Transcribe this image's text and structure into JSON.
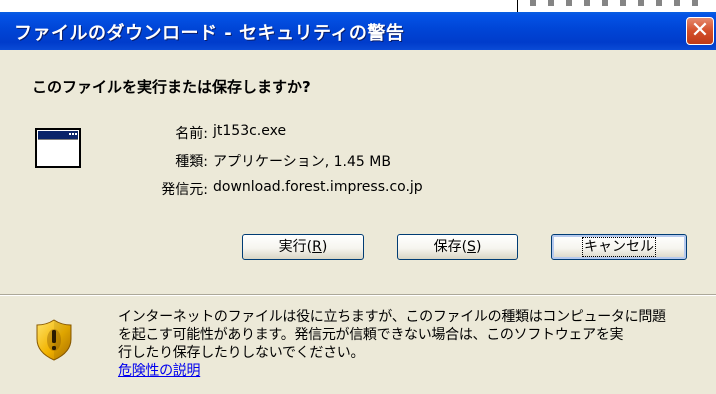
{
  "dialog": {
    "title": "ファイルのダウンロード - セキュリティの警告",
    "close_label": "✕",
    "question": "このファイルを実行または保存しますか?",
    "fields": {
      "name_label": "名前:",
      "name_value": "jt153c.exe",
      "type_label": "種類:",
      "type_value": "アプリケーション, 1.45 MB",
      "from_label": "発信元:",
      "from_value": "download.forest.impress.co.jp"
    },
    "buttons": {
      "run": {
        "text": "実行(",
        "key": "R",
        "end": ")"
      },
      "save": {
        "text": "保存(",
        "key": "S",
        "end": ")"
      },
      "cancel": "キャンセル"
    },
    "warning": {
      "line1": "インターネットのファイルは役に立ちますが、このファイルの種類はコンピュータに問題",
      "line2": "を起こす可能性があります。発信元が信頼できない場合は、このソフトウェアを実",
      "line3": "行したり保存したりしないでください。",
      "link": "危険性の説明"
    }
  },
  "colors": {
    "title_bar": "#0045D6",
    "dialog_bg": "#ECE9D8",
    "close_button": "#D44F2A",
    "link": "#0000EE",
    "shield": "#E0A400"
  }
}
